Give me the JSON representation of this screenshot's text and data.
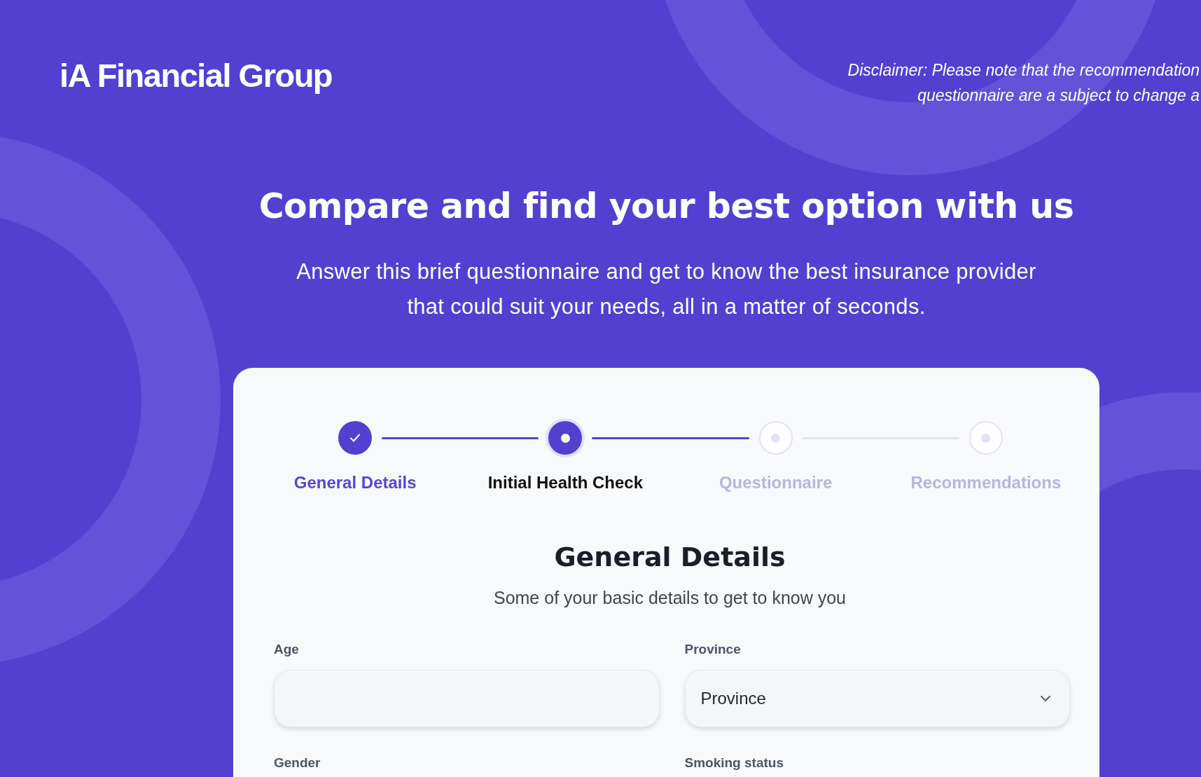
{
  "header": {
    "logo": "iA Financial Group",
    "disclaimer": [
      "Disclaimer: Please note that the recommendation",
      "questionnaire are a subject to change a"
    ]
  },
  "hero": {
    "title": "Compare and find your best option with us",
    "subtitle": "Answer this brief questionnaire and get to know the best insurance provider that could suit your needs, all in a matter of seconds."
  },
  "steps": [
    {
      "label": "General Details",
      "completed": true,
      "selected": false
    },
    {
      "label": "Initial Health Check",
      "completed": false,
      "selected": true
    },
    {
      "label": "Questionnaire",
      "completed": false,
      "selected": false
    },
    {
      "label": "Recommendations",
      "completed": false,
      "selected": false
    }
  ],
  "form": {
    "title": "General Details",
    "subtitle": "Some of your basic details to get to know you",
    "fields": [
      {
        "label": "Age",
        "kind": "text"
      },
      {
        "label": "Province",
        "kind": "select",
        "placeholder": "Province"
      },
      {
        "label": "Gender",
        "kind": "none"
      },
      {
        "label": "Smoking status",
        "kind": "none"
      }
    ]
  }
}
